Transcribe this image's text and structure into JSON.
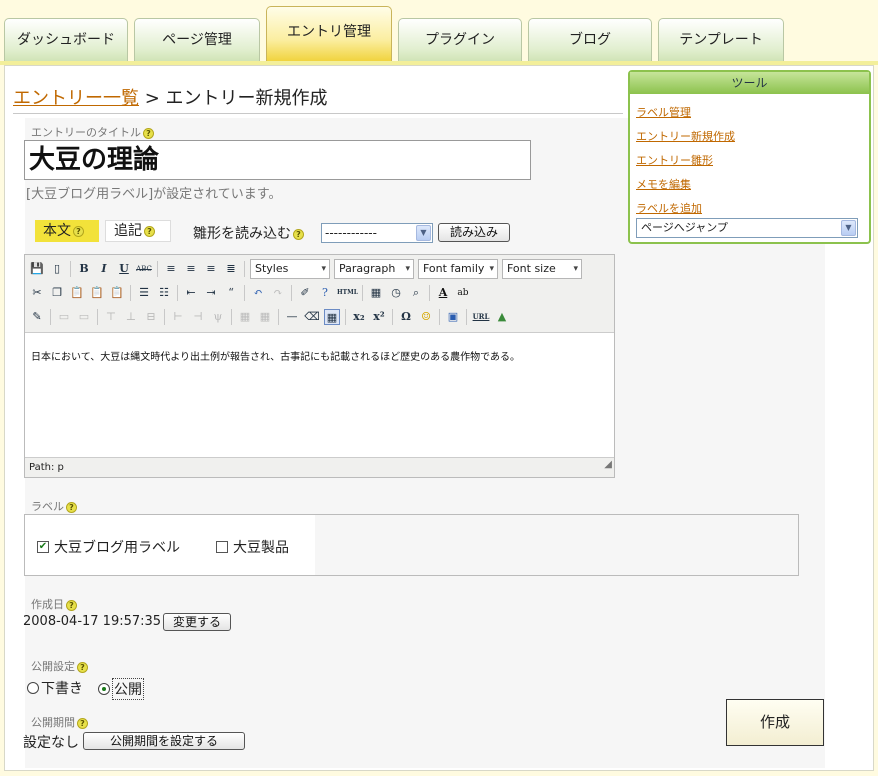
{
  "tabs": [
    "ダッシュボード",
    "ページ管理",
    "エントリ管理",
    "プラグイン",
    "ブログ",
    "テンプレート"
  ],
  "breadcrumb": {
    "link": "エントリー一覧",
    "separator": " > ",
    "current": "エントリー新規作成"
  },
  "form": {
    "title_label": "エントリーのタイトル",
    "title_value": "大豆の理論",
    "label_note": "[大豆ブログ用ラベル]が設定されています。",
    "body_tab": "本文",
    "extra_tab": "追記",
    "template_label": "雛形を読み込む",
    "template_select": "------------",
    "load_button": "読み込み",
    "editor_text": "日本において、大豆は縄文時代より出土例が報告され、古事記にも記載されるほど歴史のある農作物である。",
    "path": "Path: p",
    "dropdowns": {
      "styles": "Styles",
      "format": "Paragraph",
      "font_family": "Font family",
      "font_size": "Font size"
    },
    "toolbar_text": {
      "bold": "B",
      "italic": "I",
      "underline": "U",
      "strike": "ABC",
      "html": "HTML",
      "url": "URL"
    },
    "labels_heading": "ラベル",
    "labels": [
      {
        "name": "大豆ブログ用ラベル",
        "checked": true
      },
      {
        "name": "大豆製品",
        "checked": false
      }
    ],
    "created_heading": "作成日",
    "created_value": "2008-04-17 19:57:35",
    "change_button": "変更する",
    "publish_heading": "公開設定",
    "publish_options": [
      {
        "label": "下書き",
        "selected": false
      },
      {
        "label": "公開",
        "selected": true
      }
    ],
    "period_heading": "公開期間",
    "period_value": "設定なし",
    "period_button": "公開期間を設定する",
    "create_button": "作成"
  },
  "tools": {
    "title": "ツール",
    "items": [
      "ラベル管理",
      "エントリー新規作成",
      "エントリー雛形",
      "メモを編集",
      "ラベルを追加"
    ],
    "jump_select": "ページへジャンプ"
  },
  "colors": {
    "tab_active": "#f0d23a",
    "tools_accent": "#8cc24d",
    "link": "#c06800"
  }
}
